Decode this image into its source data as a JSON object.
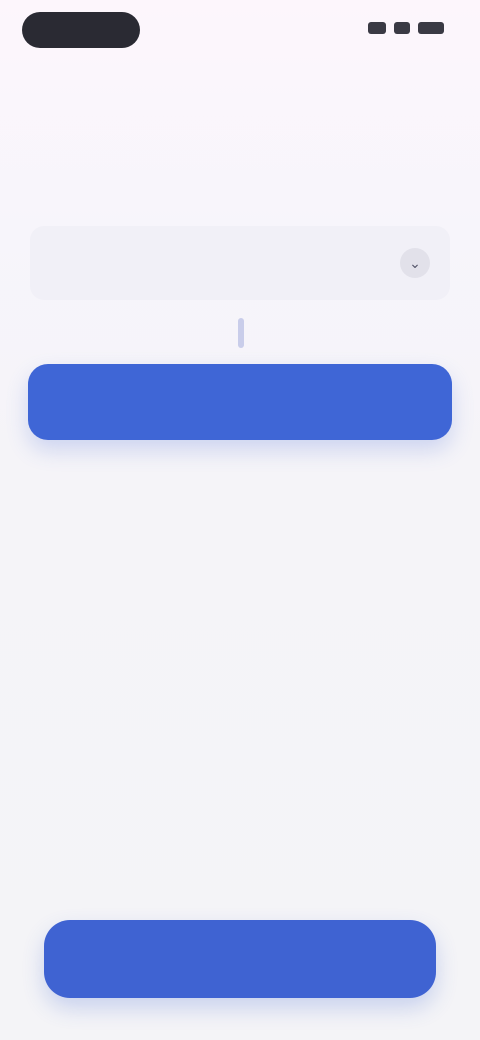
{
  "status_bar": {
    "pill_label": "",
    "icons": [
      "signal-icon",
      "wifi-icon",
      "battery-icon"
    ]
  },
  "header": {
    "nav_link": "",
    "title": "",
    "subtitle": ""
  },
  "form": {
    "select_value": "",
    "chevron_glyph": "⌄"
  },
  "actions": {
    "primary_label": "",
    "hint": "",
    "bottom_label": ""
  },
  "colors": {
    "accent": "#3f66d6",
    "background": "#f5f4f8"
  }
}
